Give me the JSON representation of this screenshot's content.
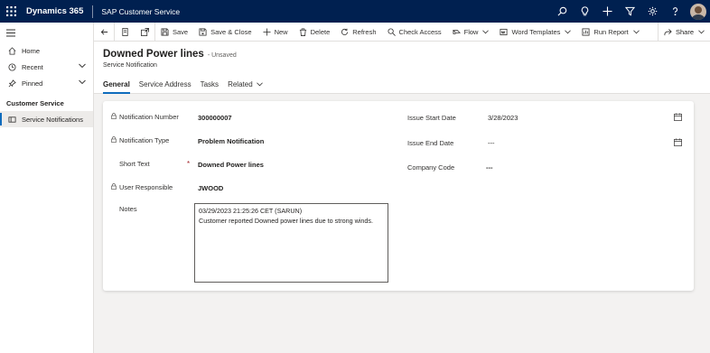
{
  "topbar": {
    "brand": "Dynamics 365",
    "app_name": "SAP Customer Service",
    "icons": [
      "search-icon",
      "lightbulb-icon",
      "plus-icon",
      "filter-icon",
      "gear-icon",
      "help-icon",
      "avatar"
    ]
  },
  "sidebar": {
    "items": [
      {
        "label": "Home",
        "icon": "home-icon"
      },
      {
        "label": "Recent",
        "icon": "clock-icon"
      },
      {
        "label": "Pinned",
        "icon": "pin-icon"
      }
    ],
    "section_title": "Customer Service",
    "section_items": [
      {
        "label": "Service Notifications",
        "icon": "entity-icon",
        "selected": true
      }
    ]
  },
  "toolbar": {
    "save": "Save",
    "save_close": "Save & Close",
    "new": "New",
    "delete": "Delete",
    "refresh": "Refresh",
    "check_access": "Check Access",
    "flow": "Flow",
    "word_templates": "Word Templates",
    "run_report": "Run Report",
    "share": "Share"
  },
  "header": {
    "title": "Downed Power lines",
    "status": "- Unsaved",
    "entity": "Service Notification"
  },
  "tabs": [
    {
      "label": "General",
      "active": true
    },
    {
      "label": "Service Address",
      "active": false
    },
    {
      "label": "Tasks",
      "active": false
    },
    {
      "label": "Related",
      "active": false
    }
  ],
  "form": {
    "notification_number": {
      "label": "Notification Number",
      "value": "300000007"
    },
    "notification_type": {
      "label": "Notification Type",
      "value": "Problem Notification"
    },
    "short_text": {
      "label": "Short Text",
      "value": "Downed Power lines",
      "required_mark": "*"
    },
    "user_responsible": {
      "label": "User Responsible",
      "value": "JWOOD"
    },
    "notes": {
      "label": "Notes",
      "line1": "03/29/2023 21:25:26 CET (SARUN)",
      "line2": "Customer reported Downed power lines due to strong winds."
    },
    "issue_start_date": {
      "label": "Issue Start Date",
      "value": "3/28/2023"
    },
    "issue_end_date": {
      "label": "Issue End Date",
      "value": "---"
    },
    "company_code": {
      "label": "Company Code",
      "value": "---"
    }
  },
  "colors": {
    "topbar": "#002050",
    "accent": "#0f6cbd",
    "background": "#f3f2f1",
    "required": "#a4262c"
  }
}
